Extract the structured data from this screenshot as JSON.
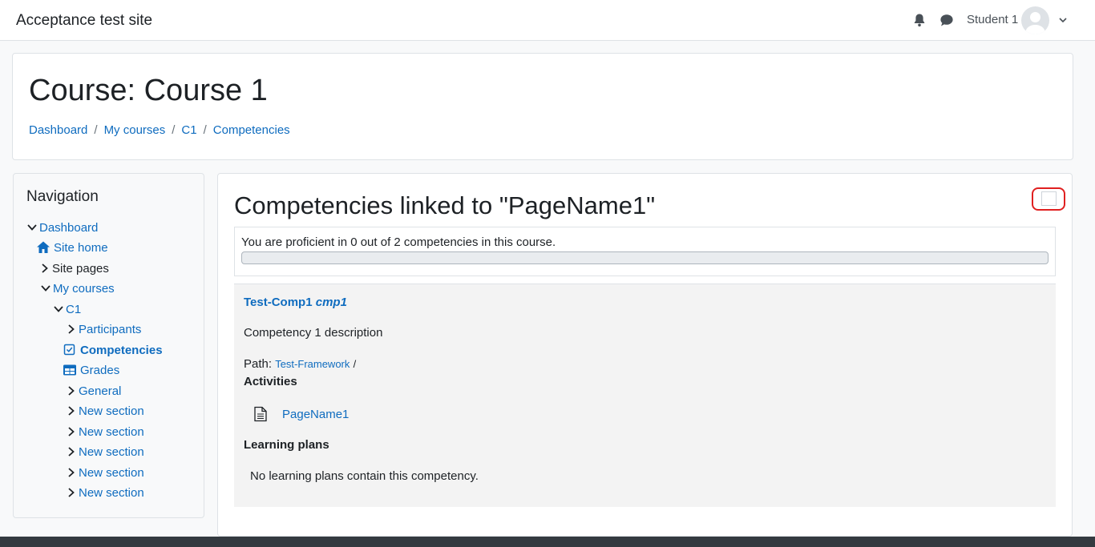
{
  "header": {
    "site_name": "Acceptance test site",
    "user_name": "Student 1",
    "icons": [
      "bell-icon",
      "chat-icon",
      "avatar",
      "chevron-down-icon"
    ]
  },
  "page": {
    "title": "Course: Course 1",
    "breadcrumb": [
      "Dashboard",
      "My courses",
      "C1",
      "Competencies"
    ],
    "breadcrumb_separator": "/"
  },
  "navigation": {
    "title": "Navigation",
    "items": [
      {
        "label": "Dashboard"
      },
      {
        "label": "Site home"
      },
      {
        "label": "Site pages"
      },
      {
        "label": "My courses"
      },
      {
        "label": "C1"
      },
      {
        "label": "Participants"
      },
      {
        "label": "Competencies"
      },
      {
        "label": "Grades"
      },
      {
        "label": "General"
      },
      {
        "label": "New section"
      },
      {
        "label": "New section"
      },
      {
        "label": "New section"
      },
      {
        "label": "New section"
      },
      {
        "label": "New section"
      }
    ]
  },
  "main": {
    "title": "Competencies linked to \"PageName1\"",
    "summary": "You are proficient in 0 out of 2 competencies in this course.",
    "proficient": 0,
    "total": 2,
    "competency": {
      "name": "Test-Comp1",
      "idnumber": "cmp1",
      "description": "Competency 1 description",
      "path_label": "Path:",
      "path_link": "Test-Framework",
      "path_sep": "/",
      "activities_heading": "Activities",
      "activity": "PageName1",
      "plans_heading": "Learning plans",
      "no_plans": "No learning plans contain this competency."
    }
  },
  "colors": {
    "link": "#0f6cbf",
    "focus_outline": "#e02020",
    "footer": "#343a40"
  }
}
